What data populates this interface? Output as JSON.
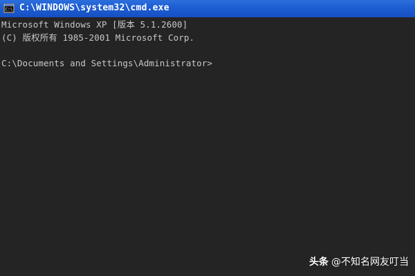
{
  "window": {
    "title": "C:\\WINDOWS\\system32\\cmd.exe",
    "icon": "cmd-icon",
    "title_color": "#ffffff",
    "titlebar_color": "#1e5ed3",
    "background_color": "#242424",
    "text_color": "#c8c8c8"
  },
  "console": {
    "lines": [
      "Microsoft Windows XP [版本 5.1.2600]",
      "(C) 版权所有 1985-2001 Microsoft Corp.",
      "",
      "C:\\Documents and Settings\\Administrator>"
    ]
  },
  "watermark": {
    "brand": "头条",
    "handle": "@不知名网友叮当"
  }
}
